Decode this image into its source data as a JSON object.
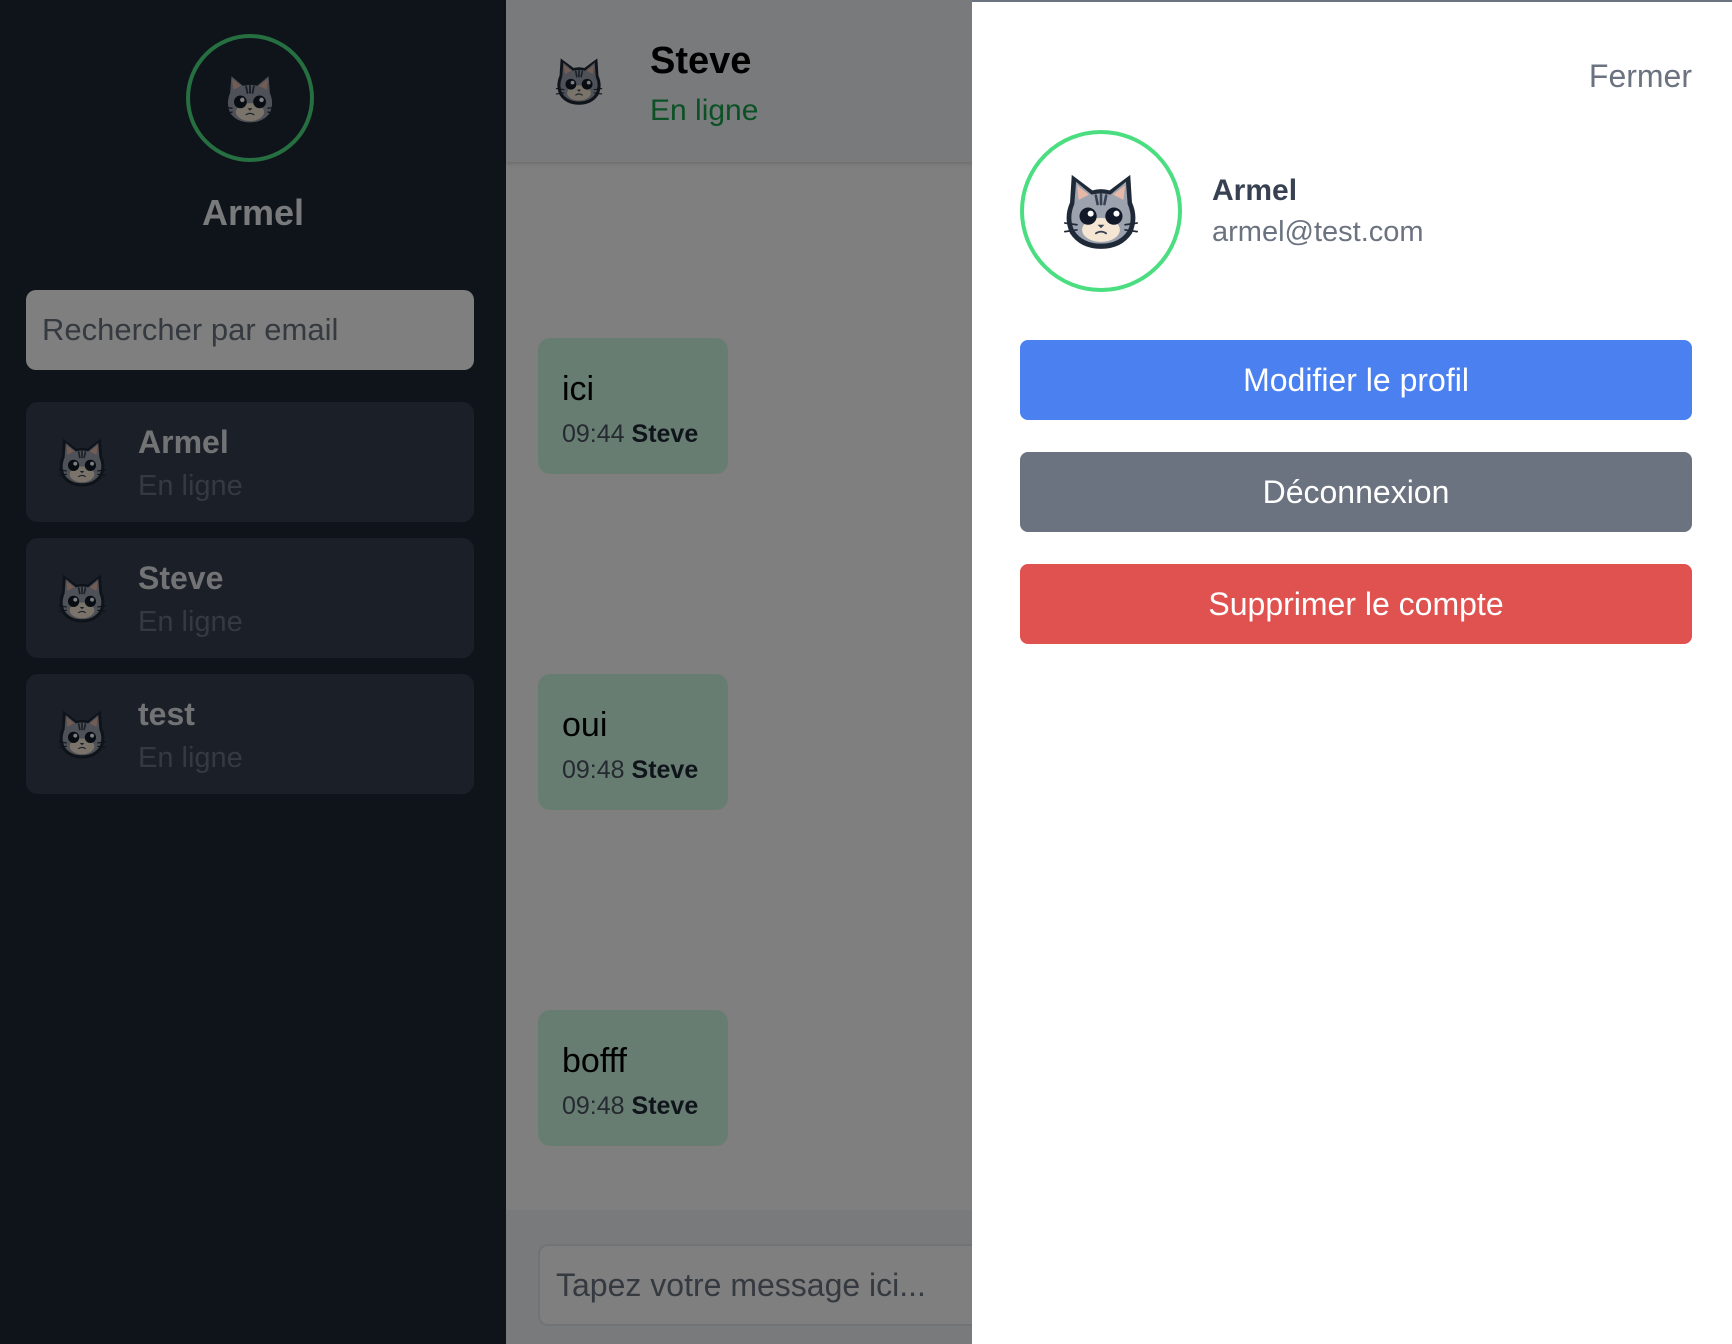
{
  "current_user": {
    "name": "Armel",
    "email": "armel@test.com"
  },
  "sidebar": {
    "search_placeholder": "Rechercher par email",
    "contacts": [
      {
        "name": "Armel",
        "status": "En ligne"
      },
      {
        "name": "Steve",
        "status": "En ligne"
      },
      {
        "name": "test",
        "status": "En ligne"
      }
    ]
  },
  "chat": {
    "contact_name": "Steve",
    "contact_status": "En ligne",
    "messages": [
      {
        "text": "ici",
        "time": "09:44",
        "sender": "Steve"
      },
      {
        "text": "oui",
        "time": "09:48",
        "sender": "Steve"
      },
      {
        "text": "bofff",
        "time": "09:48",
        "sender": "Steve"
      }
    ],
    "composer_placeholder": "Tapez votre message ici..."
  },
  "profile_panel": {
    "close_label": "Fermer",
    "edit_label": "Modifier le profil",
    "logout_label": "Déconnexion",
    "delete_label": "Supprimer le compte"
  },
  "colors": {
    "online_green": "#16a34a",
    "avatar_ring": "#4ade80",
    "edit_button": "#4b80f0",
    "logout_button": "#6b7280",
    "delete_button": "#e0524f",
    "sidebar_bg": "#1f2937",
    "message_bubble": "#d1fae5"
  },
  "icons": {
    "avatar": "cat-avatar-icon"
  }
}
